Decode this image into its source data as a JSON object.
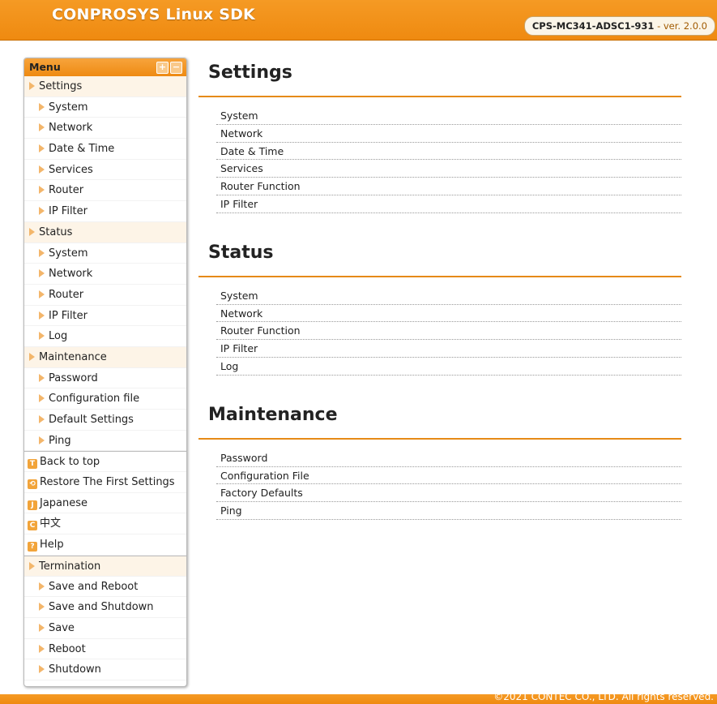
{
  "header": {
    "app_title": "CONPROSYS Linux SDK",
    "model": "CPS-MC341-ADSC1-931",
    "version": "- ver. 2.0.0"
  },
  "sidebar": {
    "menu_label": "Menu",
    "expand_symbol": "+",
    "collapse_symbol": "−",
    "settings": {
      "label": "Settings",
      "items": [
        "System",
        "Network",
        "Date & Time",
        "Services",
        "Router",
        "IP Filter"
      ]
    },
    "status": {
      "label": "Status",
      "items": [
        "System",
        "Network",
        "Router",
        "IP Filter",
        "Log"
      ]
    },
    "maintenance": {
      "label": "Maintenance",
      "items": [
        "Password",
        "Configuration file",
        "Default Settings",
        "Ping"
      ]
    },
    "utilities": [
      {
        "icon": "T",
        "label": "Back to top"
      },
      {
        "icon": "⟲",
        "label": "Restore The First Settings"
      },
      {
        "icon": "J",
        "label": "Japanese"
      },
      {
        "icon": "C",
        "label": "中文"
      },
      {
        "icon": "?",
        "label": "Help"
      }
    ],
    "termination": {
      "label": "Termination",
      "items": [
        "Save and Reboot",
        "Save and Shutdown",
        "Save",
        "Reboot",
        "Shutdown"
      ]
    }
  },
  "main": {
    "sections": [
      {
        "title": "Settings",
        "links": [
          "System",
          "Network",
          "Date & Time",
          "Services",
          "Router Function",
          "IP Filter"
        ]
      },
      {
        "title": "Status",
        "links": [
          "System",
          "Network",
          "Router Function",
          "IP Filter",
          "Log"
        ]
      },
      {
        "title": "Maintenance",
        "links": [
          "Password",
          "Configuration File",
          "Factory Defaults",
          "Ping"
        ]
      }
    ]
  },
  "footer": {
    "copyright": "©2021 CONTEC CO., LTD. All rights reserved."
  },
  "colors": {
    "accent": "#ef8a10",
    "category_bg": "#fdf4e7"
  }
}
